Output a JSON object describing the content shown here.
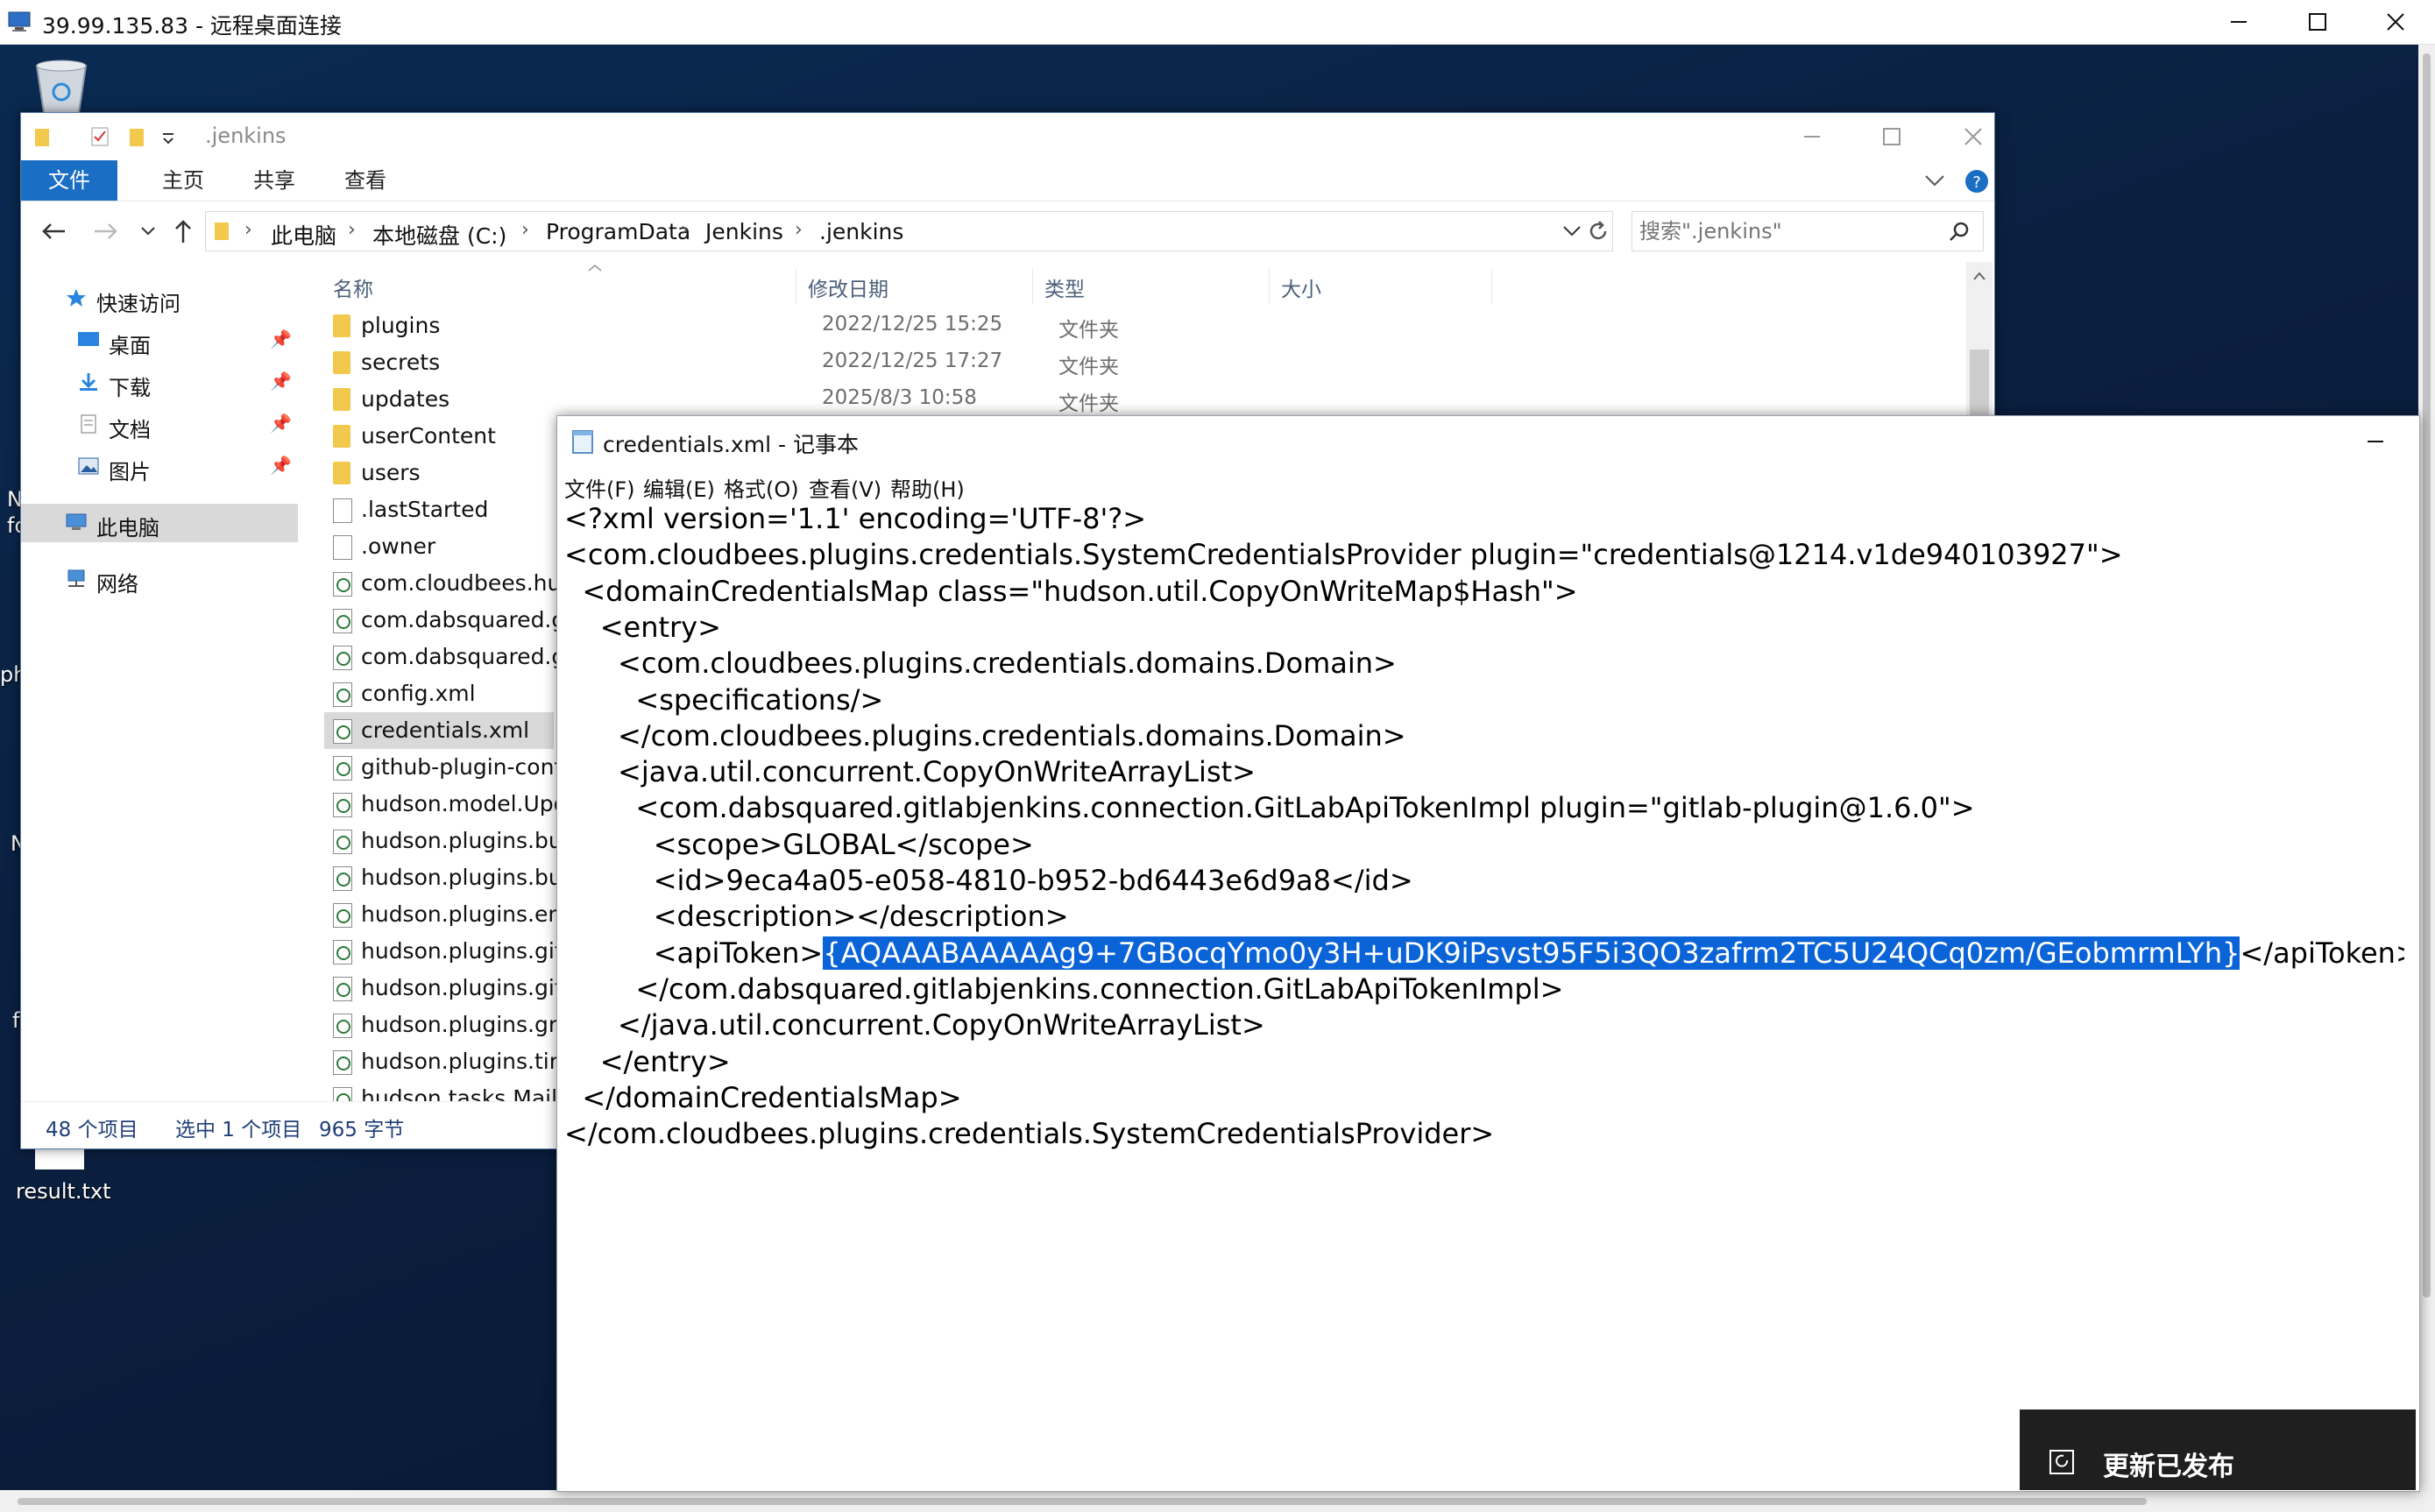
{
  "rdp": {
    "title": "39.99.135.83 - 远程桌面连接"
  },
  "desktop": {
    "labels": [
      "N",
      "fo",
      "ph",
      "N",
      "f"
    ],
    "result_file": "result.txt"
  },
  "explorer": {
    "title": ".jenkins",
    "ribbon_tabs": [
      {
        "label": "文件",
        "active": true
      },
      {
        "label": "主页",
        "active": false
      },
      {
        "label": "共享",
        "active": false
      },
      {
        "label": "查看",
        "active": false
      }
    ],
    "breadcrumb": [
      "此电脑",
      "本地磁盘 (C:)",
      "ProgramData",
      "Jenkins",
      ".jenkins"
    ],
    "search_placeholder": "搜索\".jenkins\"",
    "nav": {
      "quick_access": "快速访问",
      "desktop": "桌面",
      "downloads": "下载",
      "documents": "文档",
      "pictures": "图片",
      "this_pc": "此电脑",
      "network": "网络"
    },
    "columns": {
      "name": "名称",
      "modified": "修改日期",
      "type": "类型",
      "size": "大小"
    },
    "files": [
      {
        "name": "plugins",
        "date": "2022/12/25 15:25",
        "type": "文件夹",
        "kind": "folder"
      },
      {
        "name": "secrets",
        "date": "2022/12/25 17:27",
        "type": "文件夹",
        "kind": "folder"
      },
      {
        "name": "updates",
        "date": "2025/8/3 10:58",
        "type": "文件夹",
        "kind": "folder"
      },
      {
        "name": "userContent",
        "date": "",
        "type": "",
        "kind": "folder"
      },
      {
        "name": "users",
        "date": "",
        "type": "",
        "kind": "folder"
      },
      {
        "name": ".lastStarted",
        "date": "",
        "type": "",
        "kind": "doc"
      },
      {
        "name": ".owner",
        "date": "",
        "type": "",
        "kind": "doc"
      },
      {
        "name": "com.cloudbees.hud",
        "date": "",
        "type": "",
        "kind": "xml"
      },
      {
        "name": "com.dabsquared.gi",
        "date": "",
        "type": "",
        "kind": "xml"
      },
      {
        "name": "com.dabsquared.gi",
        "date": "",
        "type": "",
        "kind": "xml"
      },
      {
        "name": "config.xml",
        "date": "",
        "type": "",
        "kind": "xml"
      },
      {
        "name": "credentials.xml",
        "date": "",
        "type": "",
        "kind": "xml",
        "selected": true
      },
      {
        "name": "github-plugin-conf",
        "date": "",
        "type": "",
        "kind": "xml"
      },
      {
        "name": "hudson.model.Upd",
        "date": "",
        "type": "",
        "kind": "xml"
      },
      {
        "name": "hudson.plugins.bui",
        "date": "",
        "type": "",
        "kind": "xml"
      },
      {
        "name": "hudson.plugins.bui",
        "date": "",
        "type": "",
        "kind": "xml"
      },
      {
        "name": "hudson.plugins.em",
        "date": "",
        "type": "",
        "kind": "xml"
      },
      {
        "name": "hudson.plugins.git.",
        "date": "",
        "type": "",
        "kind": "xml"
      },
      {
        "name": "hudson.plugins.git.",
        "date": "",
        "type": "",
        "kind": "xml"
      },
      {
        "name": "hudson.plugins.gra",
        "date": "",
        "type": "",
        "kind": "xml"
      },
      {
        "name": "hudson.plugins.tim",
        "date": "",
        "type": "",
        "kind": "xml"
      },
      {
        "name": "hudson.tasks.Maile",
        "date": "",
        "type": "",
        "kind": "xml"
      }
    ],
    "status": {
      "count": "48 个项目",
      "selected": "选中 1 个项目",
      "size": "965 字节"
    }
  },
  "notepad": {
    "title": "credentials.xml - 记事本",
    "menu": [
      "文件(F)",
      "编辑(E)",
      "格式(O)",
      "查看(V)",
      "帮助(H)"
    ],
    "lines": [
      "<?xml version='1.1' encoding='UTF-8'?>",
      "<com.cloudbees.plugins.credentials.SystemCredentialsProvider plugin=\"credentials@1214.v1de940103927\">",
      "  <domainCredentialsMap class=\"hudson.util.CopyOnWriteMap$Hash\">",
      "    <entry>",
      "      <com.cloudbees.plugins.credentials.domains.Domain>",
      "        <specifications/>",
      "      </com.cloudbees.plugins.credentials.domains.Domain>",
      "      <java.util.concurrent.CopyOnWriteArrayList>",
      "        <com.dabsquared.gitlabjenkins.connection.GitLabApiTokenImpl plugin=\"gitlab-plugin@1.6.0\">",
      "          <scope>GLOBAL</scope>",
      "          <id>9eca4a05-e058-4810-b952-bd6443e6d9a8</id>",
      "          <description></description>",
      "          <apiToken>",
      "        </com.dabsquared.gitlabjenkins.connection.GitLabApiTokenImpl>",
      "      </java.util.concurrent.CopyOnWriteArrayList>",
      "    </entry>",
      "  </domainCredentialsMap>",
      "</com.cloudbees.plugins.credentials.SystemCredentialsProvider>"
    ],
    "api_token_value": "{AQAAABAAAAAg9+7GBocqYmo0y3H+uDK9iPsvst95F5i3QO3zafrm2TC5U24QCq0zm/GEobmrmLYh}",
    "api_token_close": "</apiToken>"
  },
  "toast": {
    "label": "更新已发布"
  },
  "colors": {
    "accent": "#1a6fc4",
    "selection": "#0a64d8",
    "desktop": "#0b1f3f"
  }
}
